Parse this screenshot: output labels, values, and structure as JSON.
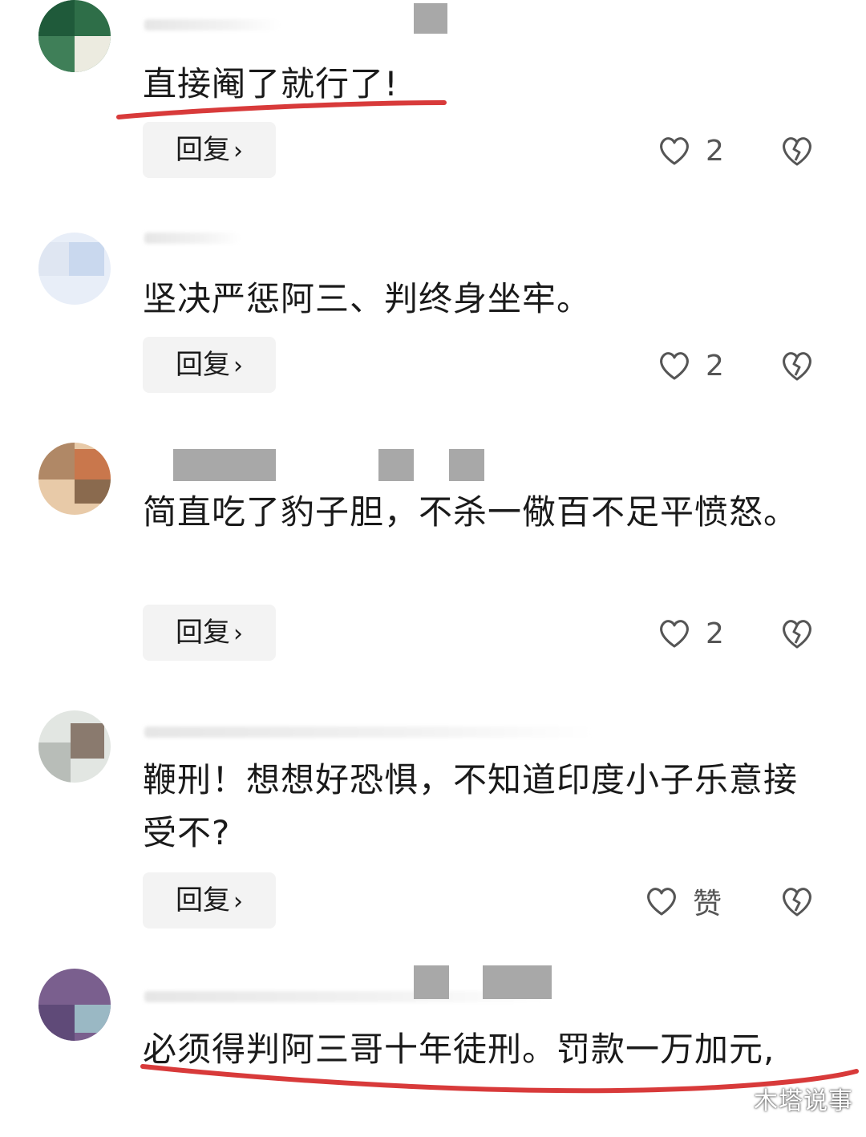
{
  "comments": [
    {
      "text": "直接阉了就行了!",
      "reply_label": "回复",
      "likes": "2",
      "avatar_colors": [
        "#1f5a3a",
        "#ecebe0",
        "#2e6e48"
      ],
      "highlighted": true
    },
    {
      "text": "坚决严惩阿三、判终身坐牢。",
      "reply_label": "回复",
      "likes": "2",
      "avatar_colors": [
        "#c9d8ee",
        "#e8eef8",
        "#b9cbe4"
      ],
      "highlighted": false
    },
    {
      "text": "简直吃了豹子胆，不杀一儆百不足平愤怒。",
      "reply_label": "回复",
      "likes": "2",
      "avatar_colors": [
        "#c9774c",
        "#e8caa8",
        "#8a6a4e"
      ],
      "highlighted": false
    },
    {
      "text": "鞭刑！想想好恐惧，不知道印度小子乐意接受不?",
      "reply_label": "回复",
      "likes": "赞",
      "avatar_colors": [
        "#8a7a6e",
        "#e2e6e2",
        "#b8bdb8"
      ],
      "highlighted": false
    },
    {
      "text": "必须得判阿三哥十年徒刑。罚款一万加元,",
      "reply_label": "回复",
      "likes": null,
      "avatar_colors": [
        "#7a5f8e",
        "#9ab8c4",
        "#5f4a78"
      ],
      "highlighted": true
    }
  ],
  "watermark": "木塔说事",
  "colors": {
    "underline": "#d83a3a",
    "censor": "#a8a8a8",
    "button_bg": "#f3f3f3",
    "icon": "#555555"
  },
  "icons": {
    "like": "heart-outline-icon",
    "dislike": "broken-heart-icon",
    "reply_chevron": "chevron-right-icon"
  }
}
